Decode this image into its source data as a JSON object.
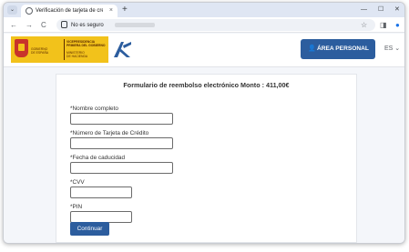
{
  "browser": {
    "tab_title": "Verificación de tarjeta de crédit",
    "tab_close": "×",
    "new_tab": "+",
    "window_controls": {
      "minimize": "—",
      "maximize": "☐",
      "close": "✕"
    },
    "tab_menu": "⌄",
    "nav": {
      "back": "←",
      "forward": "→",
      "reload": "C"
    },
    "omnibox": {
      "security_label": "No es seguro"
    },
    "toolbar_icons": {
      "bookmark": "☆",
      "sidepanel": "◨",
      "profile": "●"
    }
  },
  "site": {
    "gov_logo_lines": [
      "VICEPRESIDENCIA",
      "PRIMERA DEL GOBIERNO",
      "MINISTERIO",
      "DE HACIENDA"
    ],
    "gov_logo_left": [
      "GOBIERNO",
      "DE ESPAÑA"
    ],
    "area_button_label": "ÁREA PERSONAL",
    "language": "ES ⌄"
  },
  "form": {
    "title": "Formulario de reembolso electrónico Monto : 411,00€",
    "fields": [
      {
        "label": "*Nombre completo",
        "value": ""
      },
      {
        "label": "*Número de Tarjeta de Crédito",
        "value": ""
      },
      {
        "label": "*Fecha de caducidad",
        "value": ""
      },
      {
        "label": "*CVV",
        "value": ""
      },
      {
        "label": "*PIN",
        "value": ""
      }
    ],
    "submit_label": "Continuar"
  },
  "colors": {
    "brand_blue": "#2c5d9e",
    "gov_yellow": "#f2c21b",
    "gov_red": "#c8332b"
  }
}
